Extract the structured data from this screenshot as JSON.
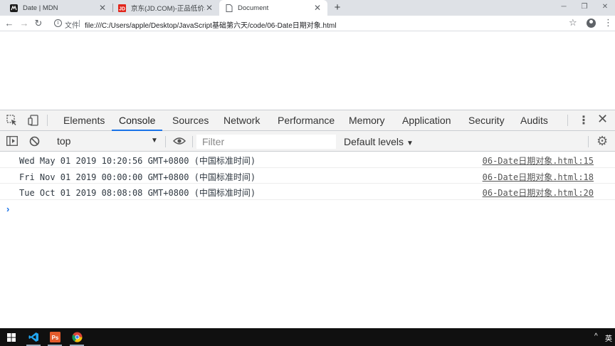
{
  "tabs": [
    {
      "title": "Date | MDN",
      "favicon": "mdn-icon"
    },
    {
      "title": "京东(JD.COM)-正品低价、品质保障",
      "favicon": "jd-icon"
    },
    {
      "title": "Document",
      "favicon": "document-icon"
    }
  ],
  "address": {
    "scheme_label": "文件",
    "url": "file:///C:/Users/apple/Desktop/JavaScript基础第六天/code/06-Date日期对象.html"
  },
  "devtools": {
    "panels": [
      "Elements",
      "Console",
      "Sources",
      "Network",
      "Performance",
      "Memory",
      "Application",
      "Security",
      "Audits"
    ],
    "active_panel": "Console",
    "context": "top",
    "filter_placeholder": "Filter",
    "levels": "Default levels",
    "accent_color": "#1a73e8",
    "messages": [
      {
        "text": "Wed May 01 2019 10:20:56 GMT+0800 (中国标准时间)",
        "source": "06-Date日期对象.html:15"
      },
      {
        "text": "Fri Nov 01 2019 00:00:00 GMT+0800 (中国标准时间)",
        "source": "06-Date日期对象.html:18"
      },
      {
        "text": "Tue Oct 01 2019 08:08:08 GMT+0800 (中国标准时间)",
        "source": "06-Date日期对象.html:20"
      }
    ]
  },
  "taskbar": {
    "items": [
      "windows-start-icon",
      "vscode-icon",
      "photoshop-icon",
      "chrome-icon"
    ],
    "tray_arrow": "^",
    "ime_label": "英"
  }
}
